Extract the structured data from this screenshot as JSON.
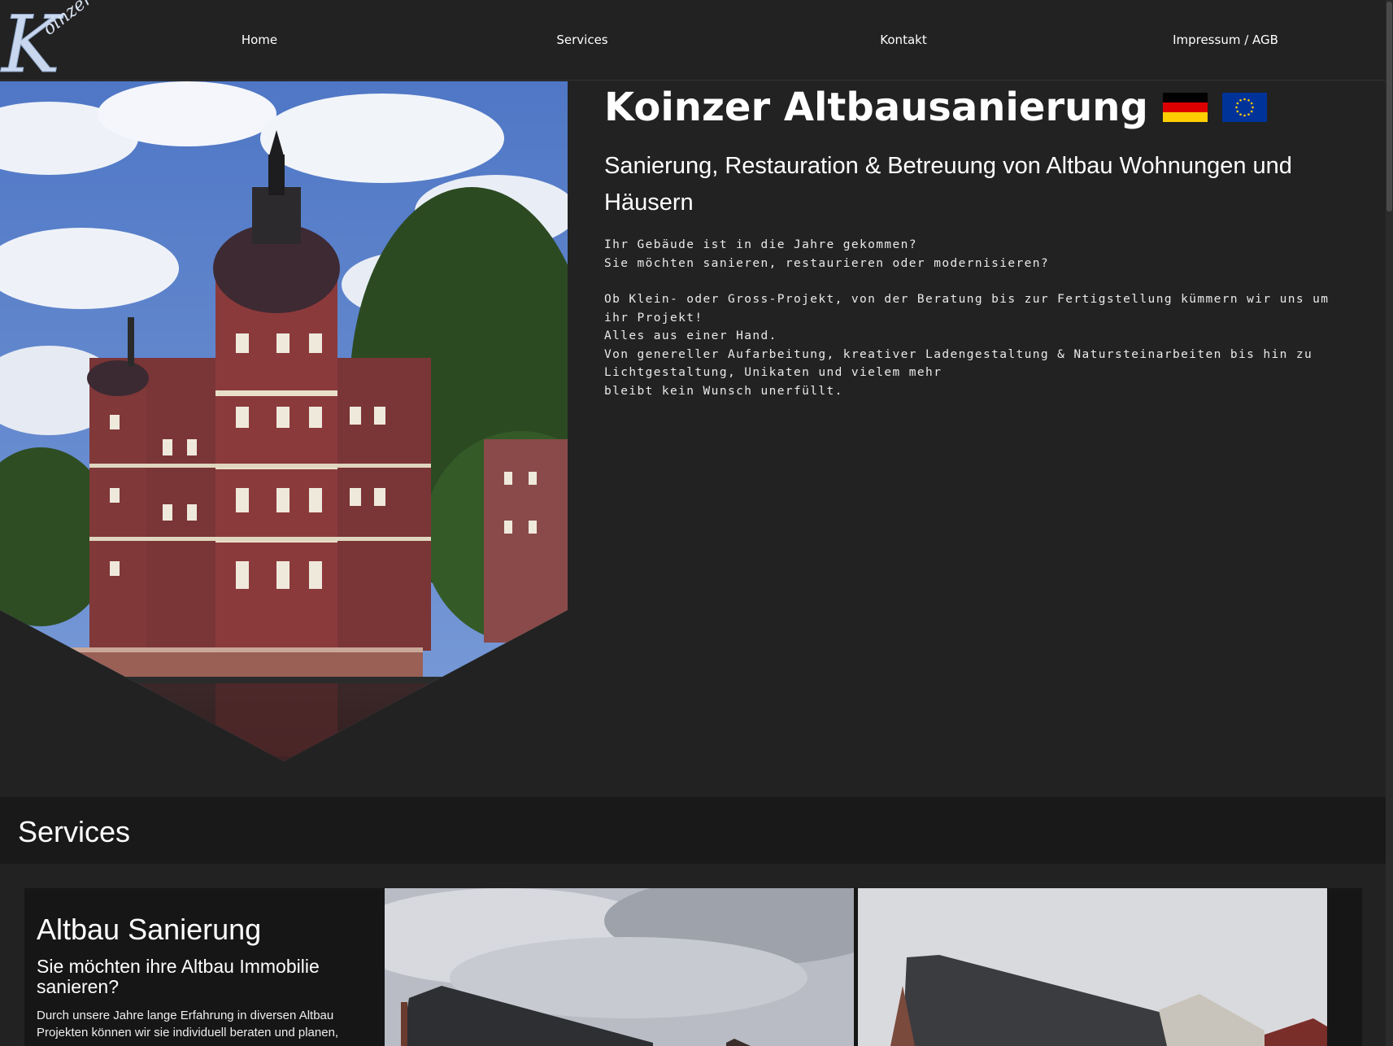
{
  "header": {
    "logo_letter": "K",
    "logo_text": "oinzer",
    "nav": [
      {
        "label": "Home"
      },
      {
        "label": "Services"
      },
      {
        "label": "Kontakt"
      },
      {
        "label": "Impressum / AGB"
      }
    ]
  },
  "hero": {
    "title": "Koinzer Altbausanierung",
    "subtitle": "Sanierung, Restauration & Betreuung von Altbau Wohnungen und Häusern",
    "body": {
      "line1": "Ihr Gebäude ist in die Jahre gekommen?",
      "line2": "Sie möchten sanieren, restaurieren oder modernisieren?",
      "line3": "Ob Klein- oder Gross-Projekt, von der Beratung bis zur Fertigstellung kümmern wir uns um ihr Projekt!",
      "line4": "Alles aus einer Hand.",
      "line5": "Von genereller Aufarbeitung, kreativer Ladengestaltung & Natursteinarbeiten bis hin zu Lichtgestaltung, Unikaten und vielem mehr",
      "line6": "bleibt kein Wunsch unerfüllt."
    }
  },
  "services": {
    "heading": "Services",
    "card": {
      "title": "Altbau Sanierung",
      "subtitle": "Sie möchten ihre Altbau Immobilie sanieren?",
      "description": "Durch unsere Jahre lange Erfahrung in diversen Altbau Projekten können wir sie individuell beraten und planen,"
    }
  },
  "colors": {
    "background": "#222222",
    "band": "#191919",
    "card": "#161616",
    "text": "#ffffff"
  }
}
